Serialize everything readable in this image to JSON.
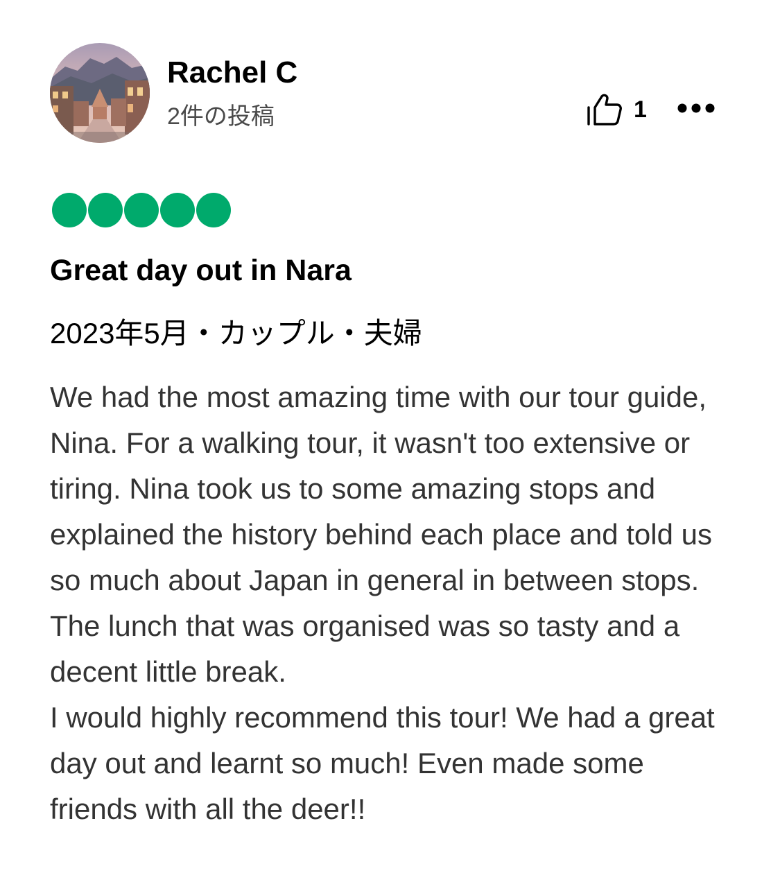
{
  "colors": {
    "rating_bubble": "#00aa6c",
    "text_primary": "#000000",
    "text_secondary": "#4a4a4a",
    "text_body": "#333333"
  },
  "reviewer": {
    "name": "Rachel C",
    "contributions": "2件の投稿",
    "avatar_icon": "avatar-photo"
  },
  "actions": {
    "helpful_icon": "thumbs-up-icon",
    "helpful_count": "1",
    "more_icon": "more-options-icon"
  },
  "rating": {
    "value": 5,
    "max": 5,
    "icon": "rating-bubble"
  },
  "review": {
    "title": "Great day out in Nara",
    "trip_info": "2023年5月・カップル・夫婦",
    "paragraphs": [
      "We had the most amazing time with our tour guide, Nina. For a walking tour, it wasn't too extensive or tiring. Nina took us to some amazing stops and explained the history behind each place and told us so much about Japan in general in between stops. The lunch that was organised was so tasty and a decent little break.",
      "I would highly recommend this tour! We had a great day out and learnt so much! Even made some friends with all the deer!!"
    ]
  }
}
